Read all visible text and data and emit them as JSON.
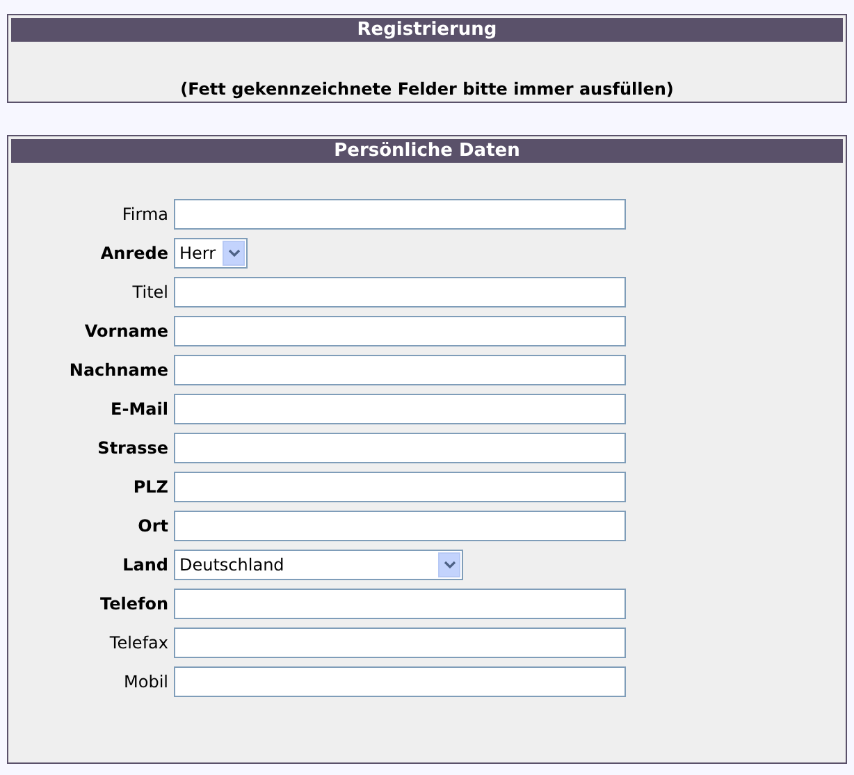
{
  "registration": {
    "title": "Registrierung",
    "note": "(Fett gekennzeichnete Felder bitte immer ausfüllen)"
  },
  "personal": {
    "title": "Persönliche Daten",
    "fields": [
      {
        "label": "Firma",
        "kind": "text",
        "required": false
      },
      {
        "label": "Anrede",
        "kind": "short-select",
        "required": true,
        "value": "Herr"
      },
      {
        "label": "Titel",
        "kind": "text",
        "required": false
      },
      {
        "label": "Vorname",
        "kind": "text",
        "required": true
      },
      {
        "label": "Nachname",
        "kind": "text",
        "required": true
      },
      {
        "label": "E-Mail",
        "kind": "text",
        "required": true
      },
      {
        "label": "Strasse",
        "kind": "text",
        "required": true
      },
      {
        "label": "PLZ",
        "kind": "text",
        "required": true
      },
      {
        "label": "Ort",
        "kind": "text",
        "required": true
      },
      {
        "label": "Land",
        "kind": "select",
        "required": true,
        "value": "Deutschland"
      },
      {
        "label": "Telefon",
        "kind": "text",
        "required": true
      },
      {
        "label": "Telefax",
        "kind": "text",
        "required": false
      },
      {
        "label": "Mobil",
        "kind": "text",
        "required": false
      }
    ]
  }
}
